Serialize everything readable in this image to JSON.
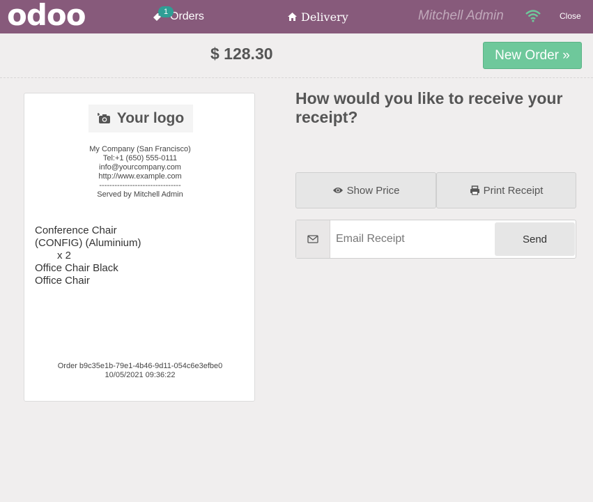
{
  "topbar": {
    "logo": "odoo",
    "orders_label": "Orders",
    "orders_count": "1",
    "delivery_label": "Delivery",
    "user": "Mitchell Admin",
    "close_label": "Close"
  },
  "order": {
    "total": "$ 128.30",
    "new_order_label": "New Order »"
  },
  "receipt": {
    "logo_text": "Your logo",
    "company": [
      "My Company (San Francisco)",
      "Tel:+1 (650) 555-0111",
      "info@yourcompany.com",
      "http://www.example.com",
      "--------------------------------",
      "Served by Mitchell Admin"
    ],
    "lines": [
      "Conference Chair",
      "(CONFIG) (Aluminium)",
      "x 2",
      "Office Chair Black",
      "Office Chair"
    ],
    "order_ref": "Order b9c35e1b-79e1-4b46-9d11-054c6e3efbe0",
    "date": "10/05/2021 09:36:22"
  },
  "panel": {
    "question": "How would you like to receive your receipt?",
    "show_price_label": "Show Price",
    "print_receipt_label": "Print Receipt",
    "email_placeholder": "Email Receipt",
    "send_label": "Send"
  },
  "colors": {
    "topbar": "#875a7b",
    "new_order": "#6ec89b",
    "badge": "#2f9e95",
    "wifi": "#6ec89b"
  }
}
